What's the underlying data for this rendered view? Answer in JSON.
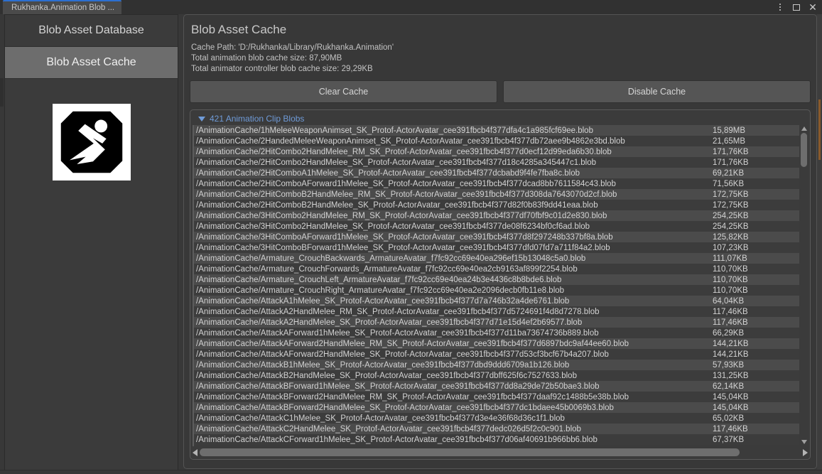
{
  "window": {
    "tab_label": "Rukhanka.Animation Blob ...",
    "controls": [
      {
        "name": "kebab-menu-icon",
        "label": "⋮"
      },
      {
        "name": "maximize-icon",
        "label": ""
      },
      {
        "name": "close-icon",
        "label": "✕"
      }
    ]
  },
  "sidebar": {
    "items": [
      {
        "label": "Blob Asset Database",
        "active": false
      },
      {
        "label": "Blob Asset Cache",
        "active": true
      }
    ],
    "logo_alt": "rukhanka-logo"
  },
  "panel": {
    "title": "Blob Asset Cache",
    "info": [
      "Cache Path: 'D:/Rukhanka/Library/Rukhanka.Animation'",
      "Total animation blob cache size: 87,90MB",
      "Total animator controller blob cache size: 29,29KB"
    ],
    "buttons": [
      {
        "label": "Clear Cache",
        "name": "clear-cache-button"
      },
      {
        "label": "Disable Cache",
        "name": "disable-cache-button"
      }
    ],
    "foldout_label": "421 Animation Clip Blobs",
    "foldout_expanded": true
  },
  "list": {
    "columns": [
      "path",
      "size"
    ],
    "rows": [
      {
        "path": "/AnimationCache/1hMeleeWeaponAnimset_SK_Protof-ActorAvatar_cee391fbcb4f377dfa4c1a985fcf69ee.blob",
        "size": "15,89MB"
      },
      {
        "path": "/AnimationCache/2HandedMeleeWeaponAnimset_SK_Protof-ActorAvatar_cee391fbcb4f377db72aee9b4862e3bd.blob",
        "size": "21,65MB"
      },
      {
        "path": "/AnimationCache/2HitCombo2HandMelee_RM_SK_Protof-ActorAvatar_cee391fbcb4f377d0ecf12d99eda6b30.blob",
        "size": "171,76KB"
      },
      {
        "path": "/AnimationCache/2HitCombo2HandMelee_SK_Protof-ActorAvatar_cee391fbcb4f377d18c4285a345447c1.blob",
        "size": "171,76KB"
      },
      {
        "path": "/AnimationCache/2HitComboA1hMelee_SK_Protof-ActorAvatar_cee391fbcb4f377dcbabd9f4fe7fba8c.blob",
        "size": "69,21KB"
      },
      {
        "path": "/AnimationCache/2HitComboAForward1hMelee_SK_Protof-ActorAvatar_cee391fbcb4f377dcad8bb7611584c43.blob",
        "size": "71,56KB"
      },
      {
        "path": "/AnimationCache/2HitComboB2HandMelee_RM_SK_Protof-ActorAvatar_cee391fbcb4f377d308da7643070d2cf.blob",
        "size": "172,75KB"
      },
      {
        "path": "/AnimationCache/2HitComboB2HandMelee_SK_Protof-ActorAvatar_cee391fbcb4f377d82f0b83f9dd41eaa.blob",
        "size": "172,75KB"
      },
      {
        "path": "/AnimationCache/3HitCombo2HandMelee_RM_SK_Protof-ActorAvatar_cee391fbcb4f377df70fbf9c01d2e830.blob",
        "size": "254,25KB"
      },
      {
        "path": "/AnimationCache/3HitCombo2HandMelee_SK_Protof-ActorAvatar_cee391fbcb4f377de08f6234bf0cf6ad.blob",
        "size": "254,25KB"
      },
      {
        "path": "/AnimationCache/3HitComboAForward1hMelee_SK_Protof-ActorAvatar_cee391fbcb4f377d8f297248b337bf8a.blob",
        "size": "125,82KB"
      },
      {
        "path": "/AnimationCache/3HitComboBForward1hMelee_SK_Protof-ActorAvatar_cee391fbcb4f377dfd07fd7a711f84a2.blob",
        "size": "107,23KB"
      },
      {
        "path": "/AnimationCache/Armature_CrouchBackwards_ArmatureAvatar_f7fc92cc69e40ea296ef15b13048c5a0.blob",
        "size": "111,07KB"
      },
      {
        "path": "/AnimationCache/Armature_CrouchForwards_ArmatureAvatar_f7fc92cc69e40ea2cb9163af899f2254.blob",
        "size": "110,70KB"
      },
      {
        "path": "/AnimationCache/Armature_CrouchLeft_ArmatureAvatar_f7fc92cc69e40ea24b3e4436c8b8bde6.blob",
        "size": "110,70KB"
      },
      {
        "path": "/AnimationCache/Armature_CrouchRight_ArmatureAvatar_f7fc92cc69e40ea2e2096decb0fb11e8.blob",
        "size": "110,70KB"
      },
      {
        "path": "/AnimationCache/AttackA1hMelee_SK_Protof-ActorAvatar_cee391fbcb4f377d7a746b32a4de6761.blob",
        "size": "64,04KB"
      },
      {
        "path": "/AnimationCache/AttackA2HandMelee_RM_SK_Protof-ActorAvatar_cee391fbcb4f377d5724691f4d8d7278.blob",
        "size": "117,46KB"
      },
      {
        "path": "/AnimationCache/AttackA2HandMelee_SK_Protof-ActorAvatar_cee391fbcb4f377d71e15d4ef2b69577.blob",
        "size": "117,46KB"
      },
      {
        "path": "/AnimationCache/AttackAForward1hMelee_SK_Protof-ActorAvatar_cee391fbcb4f377d11ba73674736b889.blob",
        "size": "66,29KB"
      },
      {
        "path": "/AnimationCache/AttackAForward2HandMelee_RM_SK_Protof-ActorAvatar_cee391fbcb4f377d6897bdc9af44ee60.blob",
        "size": "144,21KB"
      },
      {
        "path": "/AnimationCache/AttackAForward2HandMelee_SK_Protof-ActorAvatar_cee391fbcb4f377d53cf3bcf67b4a207.blob",
        "size": "144,21KB"
      },
      {
        "path": "/AnimationCache/AttackB1hMelee_SK_Protof-ActorAvatar_cee391fbcb4f377dbd9ddd6709a1b126.blob",
        "size": "57,93KB"
      },
      {
        "path": "/AnimationCache/AttackB2HandMelee_SK_Protof-ActorAvatar_cee391fbcb4f377dbff625f6c7527633.blob",
        "size": "131,25KB"
      },
      {
        "path": "/AnimationCache/AttackBForward1hMelee_SK_Protof-ActorAvatar_cee391fbcb4f377dd8a29de72b50bae3.blob",
        "size": "62,14KB"
      },
      {
        "path": "/AnimationCache/AttackBForward2HandMelee_RM_SK_Protof-ActorAvatar_cee391fbcb4f377daaf92c1488b5e38b.blob",
        "size": "145,04KB"
      },
      {
        "path": "/AnimationCache/AttackBForward2HandMelee_SK_Protof-ActorAvatar_cee391fbcb4f377dc1bdaee45b0069b3.blob",
        "size": "145,04KB"
      },
      {
        "path": "/AnimationCache/AttackC1hMelee_SK_Protof-ActorAvatar_cee391fbcb4f377d3e4e36f68d36c1f1.blob",
        "size": "65,02KB"
      },
      {
        "path": "/AnimationCache/AttackC2HandMelee_SK_Protof-ActorAvatar_cee391fbcb4f377dedc026d5f2c0c901.blob",
        "size": "117,46KB"
      },
      {
        "path": "/AnimationCache/AttackCForward1hMelee_SK_Protof-ActorAvatar_cee391fbcb4f377d06af40691b966bb6.blob",
        "size": "67,37KB"
      }
    ]
  }
}
